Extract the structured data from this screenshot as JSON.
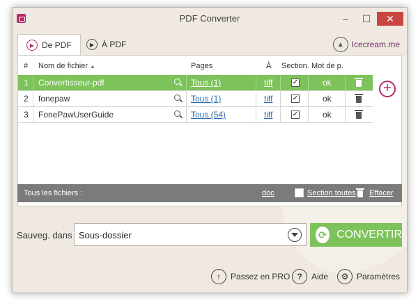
{
  "window": {
    "title": "PDF Converter"
  },
  "tabs": [
    {
      "label": "De PDF",
      "active": true
    },
    {
      "label": "À PDF",
      "active": false
    }
  ],
  "brand": {
    "label": "Icecream.me"
  },
  "table": {
    "columns": {
      "num": "#",
      "name": "Nom de fichier",
      "pages": "Pages",
      "to": "À",
      "section": "Section.",
      "password": "Mot de p."
    },
    "rows": [
      {
        "num": "1",
        "name": "Convertisseur-pdf",
        "pages": "Tous (1)",
        "format": "tiff",
        "section_checked": true,
        "password": "ok",
        "selected": true
      },
      {
        "num": "2",
        "name": "fonepaw",
        "pages": "Tous (1)",
        "format": "tiff",
        "section_checked": true,
        "password": "ok",
        "selected": false
      },
      {
        "num": "3",
        "name": "FonePawUserGuide",
        "pages": "Tous (54)",
        "format": "tiff",
        "section_checked": true,
        "password": "ok",
        "selected": false
      }
    ]
  },
  "footer": {
    "all_files": "Tous les fichiers :",
    "format": "doc",
    "section_all": "Section.toutes",
    "clear": "Effacer"
  },
  "save": {
    "label": "Sauveg. dans :",
    "value": "Sous-dossier"
  },
  "convert": {
    "label": "CONVERTIR"
  },
  "bottom": {
    "pro": "Passez en PRO",
    "help": "Aide",
    "settings": "Paramètres"
  },
  "colors": {
    "accent_green": "#7dc25a",
    "brand_pink": "#b62c6a",
    "close_red": "#c8463f",
    "footer_gray": "#7b7b7b"
  }
}
